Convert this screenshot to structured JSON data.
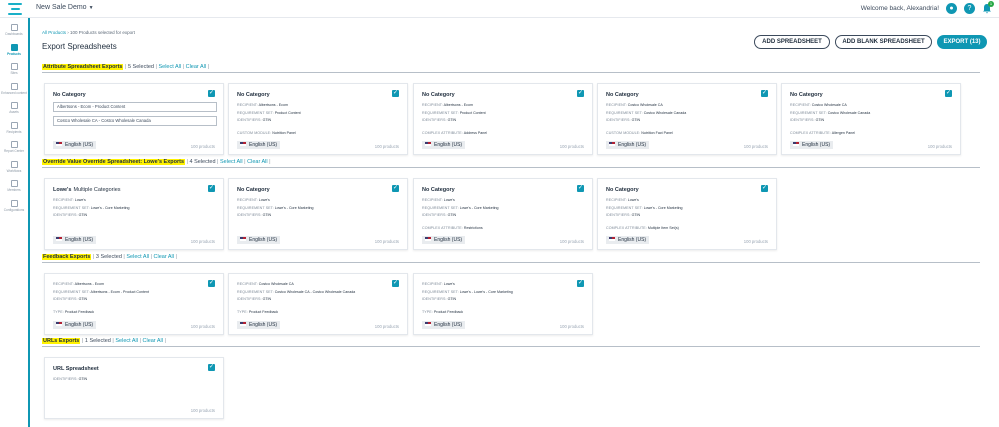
{
  "app": {
    "name": "New Sale Demo",
    "welcome": "Welcome back, Alexandria!",
    "notifications": "1"
  },
  "sidebar": [
    {
      "label": "Dashboards",
      "icon": "dashboard-icon"
    },
    {
      "label": "Products",
      "icon": "products-icon",
      "active": true
    },
    {
      "label": "Sites",
      "icon": "sites-icon"
    },
    {
      "label": "Enhanced content",
      "icon": "enhanced-content-icon"
    },
    {
      "label": "Assets",
      "icon": "assets-icon"
    },
    {
      "label": "Recipients",
      "icon": "recipients-icon"
    },
    {
      "label": "Report Center",
      "icon": "report-center-icon"
    },
    {
      "label": "Workflows",
      "icon": "workflows-icon"
    },
    {
      "label": "Members",
      "icon": "members-icon"
    },
    {
      "label": "Configurations",
      "icon": "configurations-icon"
    }
  ],
  "breadcrumb": {
    "root": "All Products",
    "separator": "›",
    "current": "100 Products selected for export"
  },
  "page": {
    "title": "Export Spreadsheets"
  },
  "buttons": {
    "add_spreadsheet": "ADD SPREADSHEET",
    "add_blank": "ADD BLANK SPREADSHEET",
    "export": "EXPORT (13)"
  },
  "common": {
    "select_all": "Select All",
    "clear_all": "Clear All",
    "pipe": "|",
    "lang": "English (US)",
    "count": "100 products",
    "check": "✓"
  },
  "sections": [
    {
      "title": "Attribute Spreadsheet Exports",
      "selected": "5 Selected",
      "cards": [
        {
          "title": "No Category",
          "fields": [
            "Albertsons - Ecom - Product Content",
            "Costco Wholesale CA - Costco Wholesale Canada"
          ],
          "meta": []
        },
        {
          "title": "No Category",
          "fields": [],
          "meta": [
            [
              "RECIPIENT:",
              "Albertsons - Ecom"
            ],
            [
              "REQUIREMENT SET:",
              "Product Content"
            ],
            [
              "IDENTIFIERS:",
              "GTIN"
            ],
            [
              "",
              ""
            ],
            [
              "CUSTOM MODULE:",
              "Nutrition Panel"
            ]
          ]
        },
        {
          "title": "No Category",
          "fields": [],
          "meta": [
            [
              "RECIPIENT:",
              "Albertsons - Ecom"
            ],
            [
              "REQUIREMENT SET:",
              "Product Content"
            ],
            [
              "IDENTIFIERS:",
              "GTIN"
            ],
            [
              "",
              ""
            ],
            [
              "COMPLEX ATTRIBUTE:",
              "Address Panel"
            ]
          ]
        },
        {
          "title": "No Category",
          "fields": [],
          "meta": [
            [
              "RECIPIENT:",
              "Costco Wholesale CA"
            ],
            [
              "REQUIREMENT SET:",
              "Costco Wholesale Canada"
            ],
            [
              "IDENTIFIERS:",
              "GTIN"
            ],
            [
              "",
              ""
            ],
            [
              "CUSTOM MODULE:",
              "Nutrition Fact Panel"
            ]
          ]
        },
        {
          "title": "No Category",
          "fields": [],
          "meta": [
            [
              "RECIPIENT:",
              "Costco Wholesale CA"
            ],
            [
              "REQUIREMENT SET:",
              "Costco Wholesale Canada"
            ],
            [
              "IDENTIFIERS:",
              "GTIN"
            ],
            [
              "",
              ""
            ],
            [
              "COMPLEX ATTRIBUTE:",
              "Allergen Panel"
            ]
          ]
        }
      ]
    },
    {
      "title": "Override Value Override Spreadsheet: Lowe's Exports",
      "selected": "4 Selected",
      "cards": [
        {
          "title": "Lowe's",
          "title_extra": "Multiple Categories",
          "fields": [],
          "meta": [
            [
              "RECIPIENT:",
              "Lowe's"
            ],
            [
              "REQUIREMENT SET:",
              "Lowe's - Core Marketing"
            ],
            [
              "IDENTIFIERS:",
              "GTIN"
            ]
          ]
        },
        {
          "title": "No Category",
          "fields": [],
          "meta": [
            [
              "RECIPIENT:",
              "Lowe's"
            ],
            [
              "REQUIREMENT SET:",
              "Lowe's - Core Marketing"
            ],
            [
              "IDENTIFIERS:",
              "GTIN"
            ]
          ]
        },
        {
          "title": "No Category",
          "fields": [],
          "meta": [
            [
              "RECIPIENT:",
              "Lowe's"
            ],
            [
              "REQUIREMENT SET:",
              "Lowe's - Core Marketing"
            ],
            [
              "IDENTIFIERS:",
              "GTIN"
            ],
            [
              "",
              ""
            ],
            [
              "COMPLEX ATTRIBUTE:",
              "Restrictions"
            ]
          ]
        },
        {
          "title": "No Category",
          "fields": [],
          "meta": [
            [
              "RECIPIENT:",
              "Lowe's"
            ],
            [
              "REQUIREMENT SET:",
              "Lowe's - Core Marketing"
            ],
            [
              "IDENTIFIERS:",
              "GTIN"
            ],
            [
              "",
              ""
            ],
            [
              "COMPLEX ATTRIBUTE:",
              "Multiple Item Set(s)"
            ]
          ]
        }
      ]
    },
    {
      "title": "Feedback Exports",
      "selected": "3 Selected",
      "cards": [
        {
          "title": "",
          "fields": [],
          "meta": [
            [
              "RECIPIENT:",
              "Albertsons - Ecom"
            ],
            [
              "REQUIREMENT SET:",
              "Albertsons - Ecom - Product Content"
            ],
            [
              "IDENTIFIERS:",
              "GTIN"
            ],
            [
              "",
              ""
            ],
            [
              "TYPE:",
              "Product Feedback"
            ]
          ]
        },
        {
          "title": "",
          "fields": [],
          "meta": [
            [
              "RECIPIENT:",
              "Costco Wholesale CA"
            ],
            [
              "REQUIREMENT SET:",
              "Costco Wholesale CA - Costco Wholesale Canada"
            ],
            [
              "IDENTIFIERS:",
              "GTIN"
            ],
            [
              "",
              ""
            ],
            [
              "TYPE:",
              "Product Feedback"
            ]
          ]
        },
        {
          "title": "",
          "fields": [],
          "meta": [
            [
              "RECIPIENT:",
              "Lowe's"
            ],
            [
              "REQUIREMENT SET:",
              "Lowe's - Lowe's - Core Marketing"
            ],
            [
              "IDENTIFIERS:",
              "GTIN"
            ],
            [
              "",
              ""
            ],
            [
              "TYPE:",
              "Product Feedback"
            ]
          ]
        }
      ]
    },
    {
      "title": "URLs Exports",
      "selected": "1 Selected",
      "cards": [
        {
          "title": "URL Spreadsheet",
          "fields": [],
          "meta": [
            [
              "IDENTIFIERS:",
              "GTIN"
            ]
          ],
          "no_lang": true
        }
      ]
    }
  ],
  "colors": {
    "accent": "#0f97b3",
    "highlight": "#fff200"
  }
}
